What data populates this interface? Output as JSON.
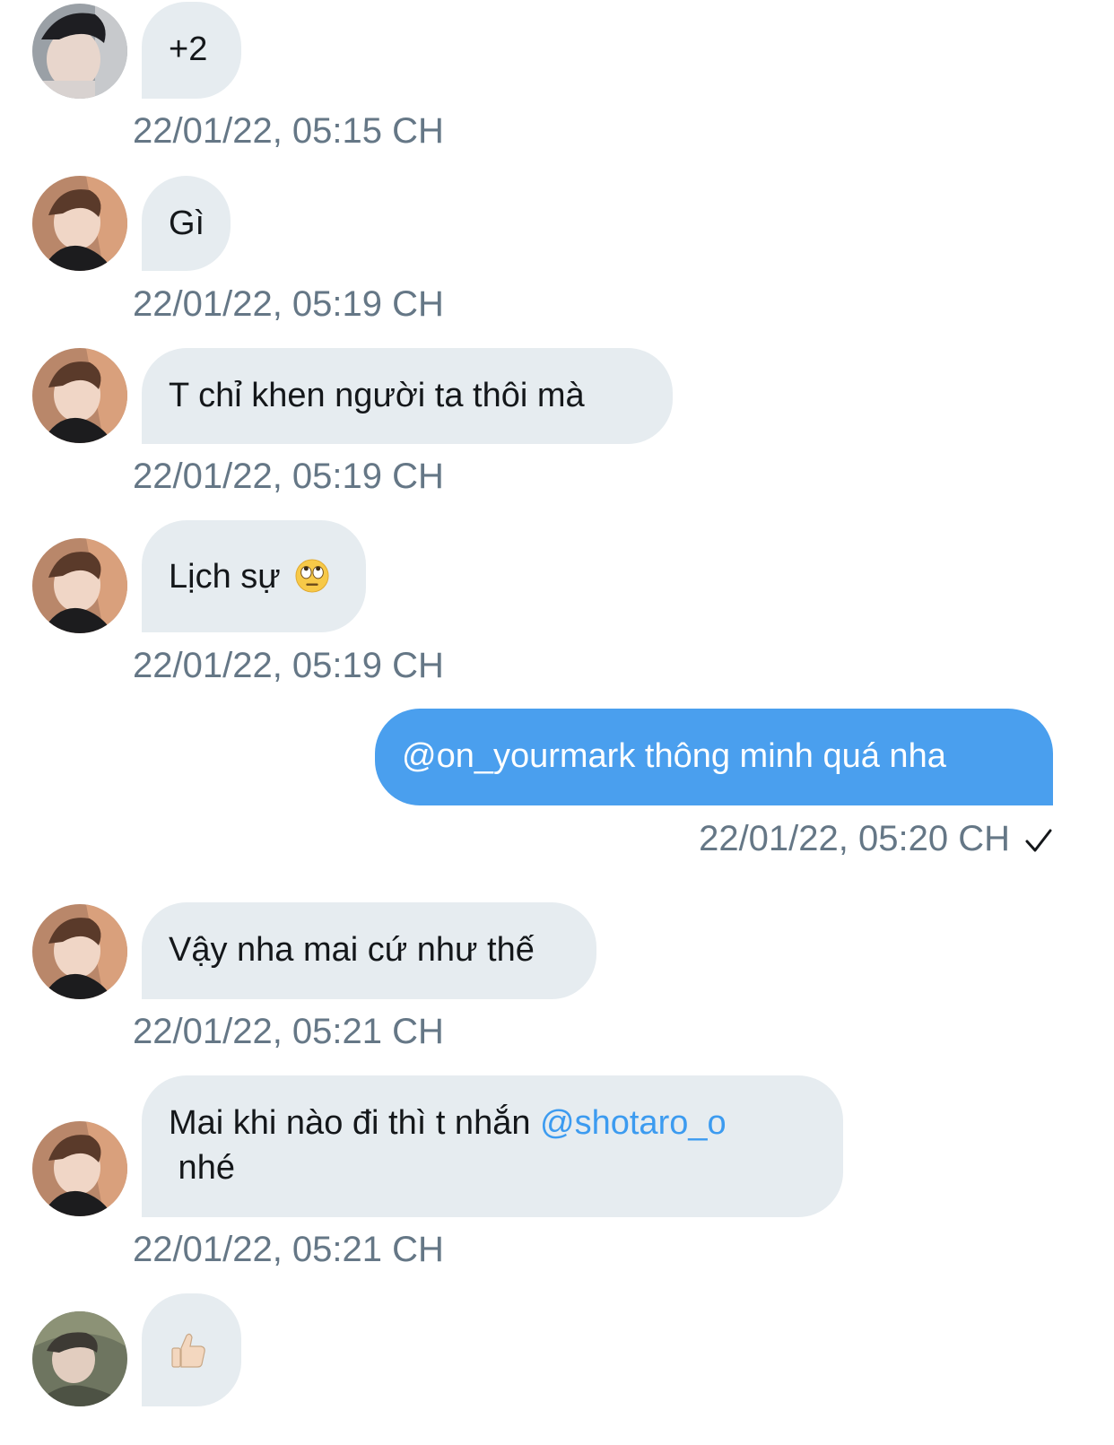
{
  "messages": [
    {
      "text": "+2",
      "time": "22/01/22, 05:15 CH",
      "avatar": "avatar-user-a"
    },
    {
      "text": "Gì",
      "time": "22/01/22, 05:19 CH",
      "avatar": "avatar-user-b"
    },
    {
      "text": "T chỉ khen người ta thôi mà",
      "time": "22/01/22, 05:19 CH",
      "avatar": "avatar-user-b"
    },
    {
      "text": "Lịch sự",
      "emoji": "face-with-rolling-eyes",
      "time": "22/01/22, 05:19 CH",
      "avatar": "avatar-user-b"
    },
    {
      "text": "@on_yourmark thông minh quá nha",
      "time": "22/01/22, 05:20 CH",
      "status": "sent-check-icon"
    },
    {
      "text": "Vậy nha mai cứ như thế",
      "time": "22/01/22, 05:21 CH",
      "avatar": "avatar-user-b"
    },
    {
      "text_before": "Mai khi nào đi thì t nhắn ",
      "mention": "@shotaro_o",
      "text_after": " nhé",
      "time": "22/01/22, 05:21 CH",
      "avatar": "avatar-user-b"
    },
    {
      "emoji": "thumbs-up-light-skin",
      "avatar": "avatar-user-c"
    }
  ],
  "colors": {
    "incoming_bubble": "#e6ecf0",
    "outgoing_bubble": "#4a9fee",
    "timestamp": "#657786",
    "mention": "#3c9bf0"
  }
}
